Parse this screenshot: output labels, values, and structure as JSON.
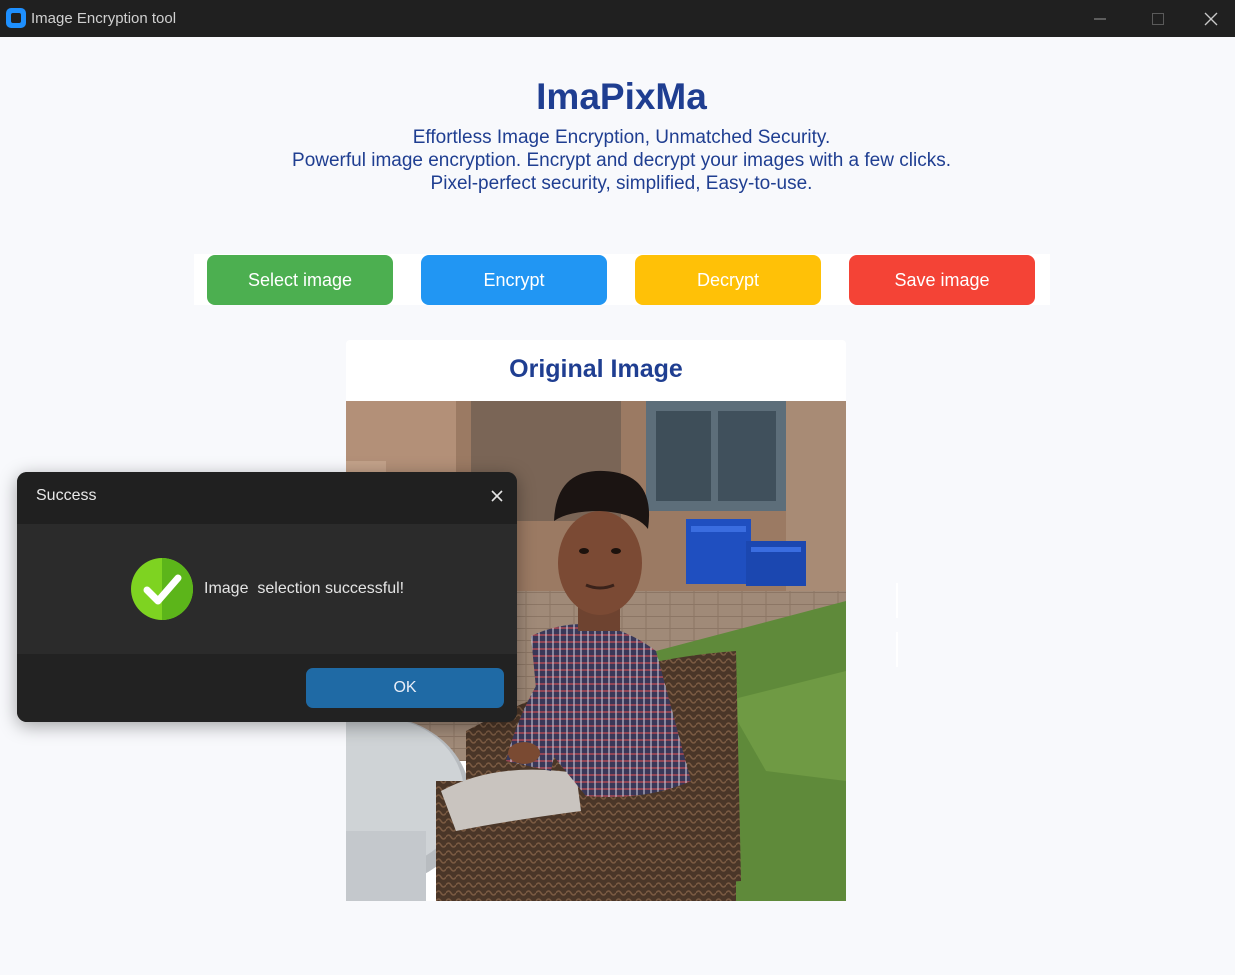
{
  "window": {
    "title": "Image Encryption tool",
    "icons": {
      "app": "app-icon",
      "minimize": "minimize-icon",
      "maximize": "maximize-icon",
      "close": "close-icon"
    }
  },
  "header": {
    "app_name": "ImaPixMa",
    "tagline_lines": [
      "Effortless Image Encryption, Unmatched Security.",
      "Powerful image encryption. Encrypt and decrypt your images with a few clicks.",
      "Pixel-perfect security, simplified, Easy-to-use."
    ]
  },
  "toolbar": {
    "select_label": "Select image",
    "encrypt_label": "Encrypt",
    "decrypt_label": "Decrypt",
    "save_label": "Save image"
  },
  "colors": {
    "title": "#1f3e91",
    "select": "#4caf50",
    "encrypt": "#2196f3",
    "decrypt": "#ffc107",
    "save": "#f44336",
    "ok": "#1f6aa5",
    "success_icon": "#7ed321"
  },
  "panel": {
    "title": "Original Image",
    "image_alt": "photo of a man sitting in a wicker chair outdoors"
  },
  "dialog": {
    "title": "Success",
    "message": "Image  selection successful!",
    "ok_label": "OK",
    "icon": "check-circle-icon"
  }
}
